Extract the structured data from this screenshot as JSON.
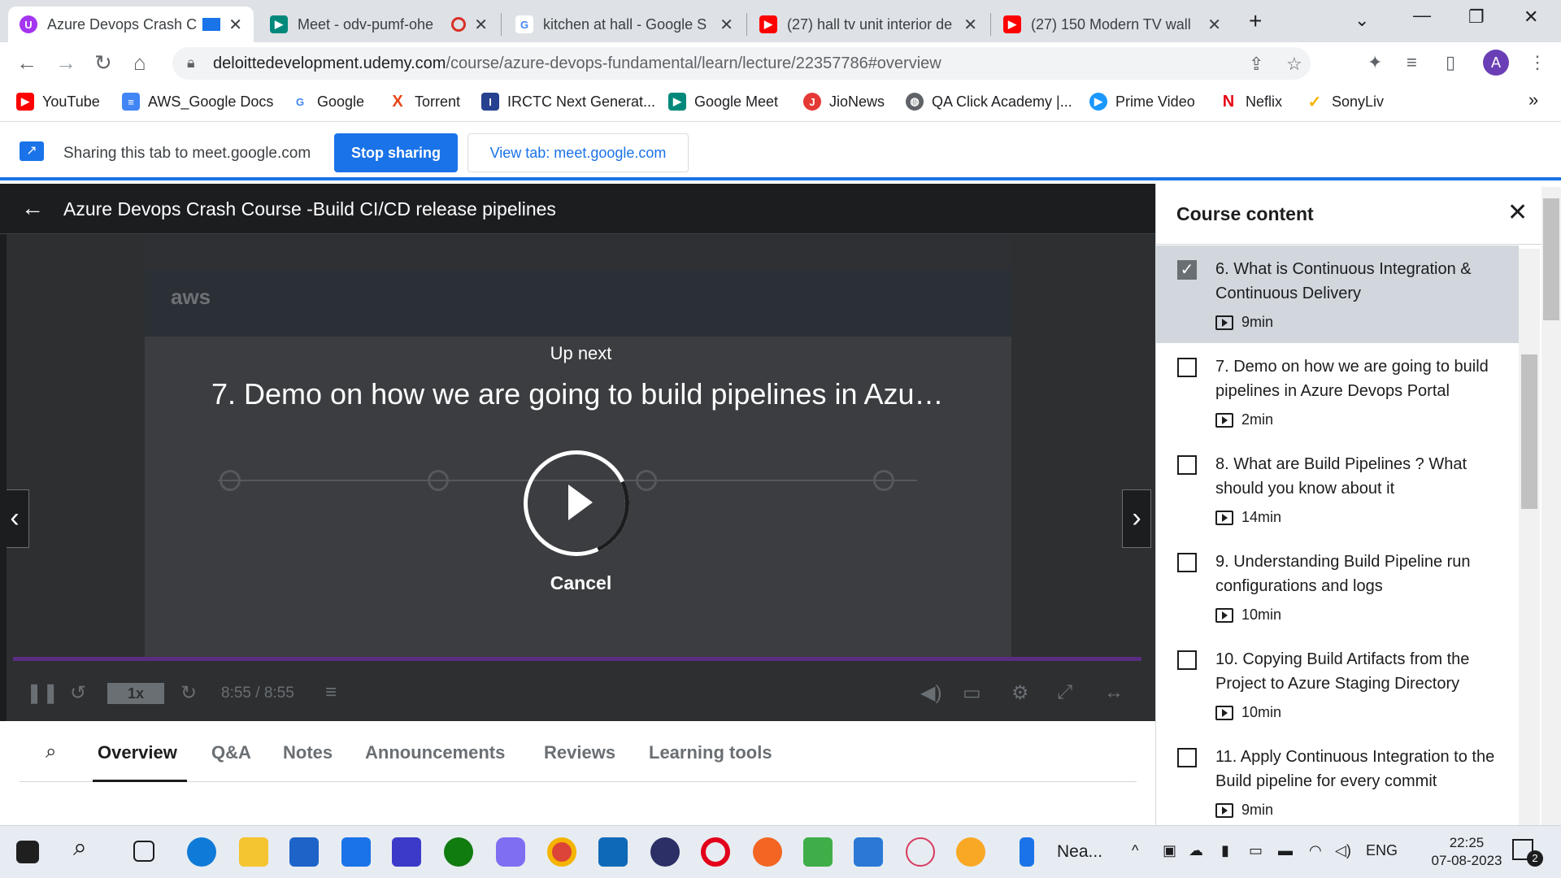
{
  "browser": {
    "tabs": [
      {
        "title": "Azure Devops Crash C",
        "icon": "udemy-icon",
        "color": "#a435f0",
        "active": true
      },
      {
        "title": "Meet - odv-pumf-ohe",
        "icon": "google-meet-icon",
        "color": "#00897b",
        "active": false
      },
      {
        "title": "kitchen at hall - Google S",
        "icon": "google-icon",
        "color": "#4285f4",
        "active": false
      },
      {
        "title": "(27) hall tv unit interior de",
        "icon": "youtube-icon",
        "color": "#ff0000",
        "active": false
      },
      {
        "title": "(27) 150 Modern TV wall",
        "icon": "youtube-icon",
        "color": "#ff0000",
        "active": false
      }
    ],
    "new_tab": "+",
    "url_host": "deloittedevelopment.udemy.com",
    "url_path": "/course/azure-devops-fundamental/learn/lecture/22357786#overview",
    "profile_initial": "A"
  },
  "bookmarks": [
    {
      "label": "YouTube",
      "icon": "youtube-icon",
      "color": "#ff0000"
    },
    {
      "label": "AWS_Google Docs",
      "icon": "docs-icon",
      "color": "#4285f4"
    },
    {
      "label": "Google",
      "icon": "google-icon",
      "color": "#4285f4"
    },
    {
      "label": "Torrent",
      "icon": "torrent-icon",
      "color": "#e8471a"
    },
    {
      "label": "IRCTC Next Generat...",
      "icon": "irctc-icon",
      "color": "#26418f"
    },
    {
      "label": "Google Meet",
      "icon": "google-meet-icon",
      "color": "#00897b"
    },
    {
      "label": "JioNews",
      "icon": "jionews-icon",
      "color": "#e53935"
    },
    {
      "label": "QA Click Academy |...",
      "icon": "globe-icon",
      "color": "#5f6368"
    },
    {
      "label": "Prime Video",
      "icon": "prime-video-icon",
      "color": "#1a98ff"
    },
    {
      "label": "Neflix",
      "icon": "netflix-icon",
      "color": "#e50914"
    },
    {
      "label": "SonyLiv",
      "icon": "sonyliv-icon",
      "color": "#f4b400"
    }
  ],
  "bookmarks_overflow": "»",
  "share": {
    "text": "Sharing this tab to meet.google.com",
    "stop": "Stop sharing",
    "view": "View tab: meet.google.com"
  },
  "player": {
    "course_title": "Azure Devops Crash Course -Build CI/CD release pipelines",
    "up_next": "Up next",
    "next_title": "7. Demo on how we are going to build pipelines in Azu…",
    "cancel": "Cancel",
    "rate": "1x",
    "time": "8:55 / 8:55",
    "video_brand": "aws"
  },
  "lecture_tabs": [
    "Overview",
    "Q&A",
    "Notes",
    "Announcements",
    "Reviews",
    "Learning tools"
  ],
  "sidebar": {
    "title": "Course content",
    "items": [
      {
        "title": "6. What is Continuous Integration & Continuous Delivery",
        "duration": "9min",
        "done": true,
        "current": true
      },
      {
        "title": "7. Demo on how we are going to build pipelines in Azure Devops Portal",
        "duration": "2min",
        "done": false,
        "current": false
      },
      {
        "title": "8. What are Build Pipelines ? What should you know about it",
        "duration": "14min",
        "done": false,
        "current": false
      },
      {
        "title": "9. Understanding Build Pipeline run configurations and logs",
        "duration": "10min",
        "done": false,
        "current": false
      },
      {
        "title": "10. Copying Build Artifacts from the Project to Azure Staging Directory",
        "duration": "10min",
        "done": false,
        "current": false
      },
      {
        "title": "11. Apply Continuous Integration to the Build pipeline for every commit",
        "duration": "9min",
        "done": false,
        "current": false
      }
    ]
  },
  "taskbar": {
    "weather": "Nea...",
    "language": "ENG",
    "time": "22:25",
    "date": "07-08-2023",
    "notification_count": "2"
  }
}
